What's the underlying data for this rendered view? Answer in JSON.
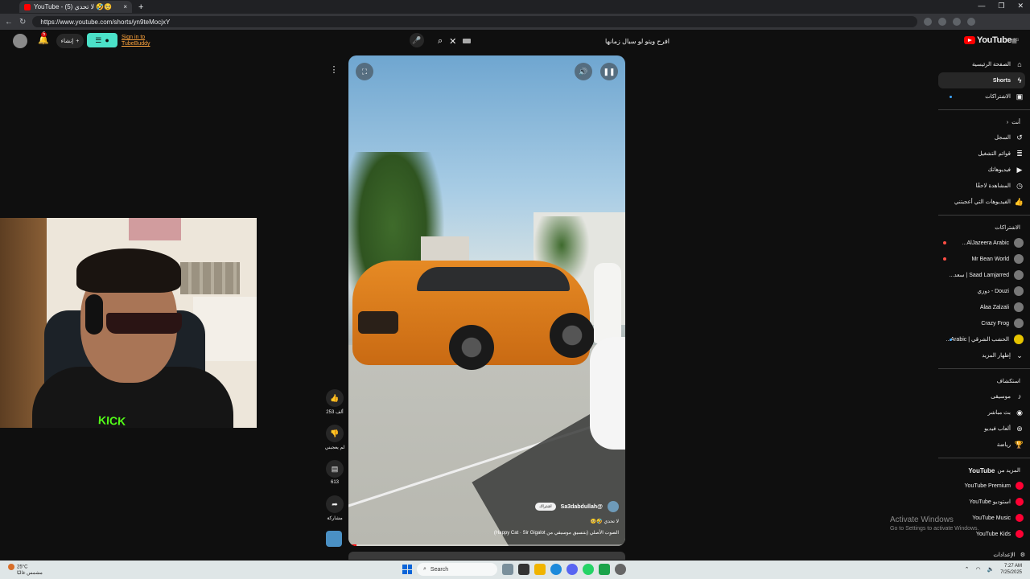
{
  "browser": {
    "tab_title": "YouTube - (5) لا تحدي 🤣🥺",
    "url": "https://www.youtube.com/shorts/yn9teMocjxY",
    "new_tab_label": "+",
    "tab_close": "×"
  },
  "header": {
    "notif_count": "5",
    "create_label": "إنشاء",
    "tubebuddy_signin": "Sign in to TubeBuddy",
    "search_query": "افرح ويتو لو سبال زمانها",
    "logo_text": "YouTube",
    "logo_region": "EG"
  },
  "sidebar": {
    "main": [
      {
        "label": "الصفحة الرئيسية",
        "icon": "home-icon"
      },
      {
        "label": "Shorts",
        "icon": "shorts-icon",
        "active": true
      },
      {
        "label": "الاشتراكات",
        "icon": "subscriptions-icon",
        "dot": true
      }
    ],
    "you_heading": "أنت",
    "you": [
      {
        "label": "السجل",
        "icon": "history-icon"
      },
      {
        "label": "قوائم التشغيل",
        "icon": "playlists-icon"
      },
      {
        "label": "فيديوهاتك",
        "icon": "your-videos-icon"
      },
      {
        "label": "المشاهدة لاحقًا",
        "icon": "watch-later-icon"
      },
      {
        "label": "الفيديوهات التي أعجبتني",
        "icon": "liked-icon"
      }
    ],
    "subs_heading": "الاشتراكات",
    "subs": [
      {
        "label": "AlJazeera Arabic...",
        "live": true
      },
      {
        "label": "Mr Bean World",
        "live": true
      },
      {
        "label": "Saad Lamjarred | سعد..."
      },
      {
        "label": "Douzi - دوزي"
      },
      {
        "label": "Alaa Zalzali"
      },
      {
        "label": "Crazy Frog"
      },
      {
        "label": "الحشب الشرقي | Arabic...",
        "dot": true
      }
    ],
    "show_more": "إظهار المزيد",
    "explore_heading": "استكشاف",
    "explore": [
      {
        "label": "موسيقى",
        "icon": "music-icon"
      },
      {
        "label": "بث مباشر",
        "icon": "live-icon"
      },
      {
        "label": "ألعاب فيديو",
        "icon": "gaming-icon"
      },
      {
        "label": "رياضة",
        "icon": "sports-icon"
      }
    ],
    "more_heading_prefix": "المزيد من",
    "more_heading_brand": "YouTube",
    "more": [
      {
        "label": "YouTube Premium"
      },
      {
        "label": "استوديو YouTube"
      },
      {
        "label": "YouTube Music"
      },
      {
        "label": "YouTube Kids"
      }
    ],
    "settings_label": "الإعدادات"
  },
  "short": {
    "channel": "@Sa3dabdullah",
    "subscribe_label": "اشتراك",
    "title": "لا تحدي 🤣🥺",
    "music": "الصوت الأصلي (بتنسيق موسيقي من Happy Cat · Sir Gigalot)",
    "progress": 0.03
  },
  "actions": {
    "like_count": "253 ألف",
    "dislike_label": "لم يعجبني",
    "comment_count": "613",
    "share_label": "مشاركة"
  },
  "overlay": {
    "activate_title": "Activate Windows",
    "activate_sub": "Go to Settings to activate Windows."
  },
  "taskbar": {
    "weather_temp": "25°C",
    "weather_desc": "مشمس غالبًا",
    "search_label": "Search",
    "time": "7:27 AM",
    "date": "7/25/2025"
  }
}
